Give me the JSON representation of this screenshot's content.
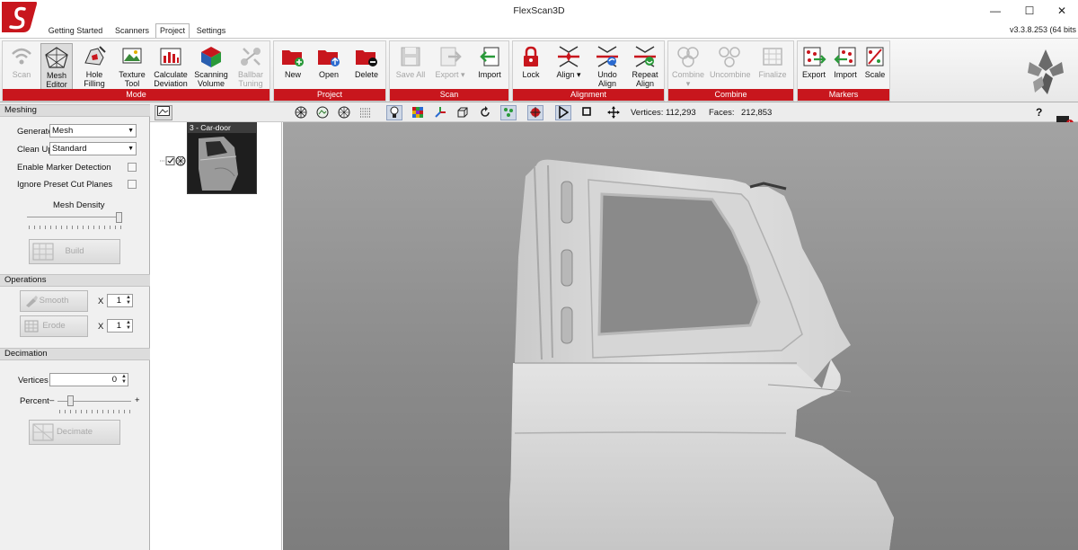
{
  "window": {
    "title": "FlexScan3D",
    "version": "v3.3.8.253  (64 bits"
  },
  "tabs": [
    "Getting Started",
    "Scanners",
    "Project",
    "Settings"
  ],
  "ribbon": {
    "groups": [
      {
        "label": "Mode",
        "buttons": [
          {
            "line1": "Scan",
            "line2": "",
            "state": "disabled"
          },
          {
            "line1": "Mesh",
            "line2": "Editor",
            "state": "selected"
          },
          {
            "line1": "Hole",
            "line2": "Filling",
            "state": "normal"
          },
          {
            "line1": "Texture",
            "line2": "Tool",
            "state": "normal"
          },
          {
            "line1": "Calculate",
            "line2": "Deviation",
            "state": "normal"
          },
          {
            "line1": "Scanning",
            "line2": "Volume",
            "state": "normal"
          },
          {
            "line1": "Ballbar",
            "line2": "Tuning",
            "state": "disabled"
          }
        ]
      },
      {
        "label": "Project",
        "buttons": [
          {
            "line1": "New",
            "line2": "",
            "state": "normal"
          },
          {
            "line1": "Open",
            "line2": "",
            "state": "normal"
          },
          {
            "line1": "Delete",
            "line2": "",
            "state": "normal"
          }
        ]
      },
      {
        "label": "Scan",
        "buttons": [
          {
            "line1": "Save All",
            "line2": "",
            "state": "disabled"
          },
          {
            "line1": "Export ▾",
            "line2": "",
            "state": "disabled"
          },
          {
            "line1": "Import",
            "line2": "",
            "state": "normal"
          }
        ]
      },
      {
        "label": "Alignment",
        "buttons": [
          {
            "line1": "Lock",
            "line2": "",
            "state": "normal"
          },
          {
            "line1": "Align ▾",
            "line2": "",
            "state": "normal"
          },
          {
            "line1": "Undo",
            "line2": "Align",
            "state": "normal"
          },
          {
            "line1": "Repeat",
            "line2": "Align",
            "state": "normal"
          }
        ]
      },
      {
        "label": "Combine",
        "buttons": [
          {
            "line1": "Combine",
            "line2": "▾",
            "state": "disabled"
          },
          {
            "line1": "Uncombine",
            "line2": "",
            "state": "disabled"
          },
          {
            "line1": "Finalize",
            "line2": "",
            "state": "disabled"
          }
        ]
      },
      {
        "label": "Markers",
        "buttons": [
          {
            "line1": "Export",
            "line2": "",
            "state": "normal"
          },
          {
            "line1": "Import",
            "line2": "",
            "state": "normal"
          },
          {
            "line1": "Scale",
            "line2": "",
            "state": "normal"
          }
        ]
      }
    ]
  },
  "viewbar": {
    "vertices_label": "Vertices:",
    "vertices_value": "112,293",
    "faces_label": "Faces:",
    "faces_value": "212,853",
    "help": "?"
  },
  "panel": {
    "meshing": {
      "title": "Meshing",
      "generate_label": "Generate",
      "generate_value": "Mesh",
      "cleanup_label": "Clean Up",
      "cleanup_value": "Standard",
      "marker_detection_label": "Enable Marker Detection",
      "ignore_planes_label": "Ignore Preset Cut Planes",
      "density_label": "Mesh Density",
      "density_level": 1.0,
      "build_label": "Build"
    },
    "operations": {
      "title": "Operations",
      "smooth_label": "Smooth",
      "smooth_x": "X",
      "smooth_value": "1",
      "erode_label": "Erode",
      "erode_x": "X",
      "erode_value": "1"
    },
    "decimation": {
      "title": "Decimation",
      "vertices_label": "Vertices",
      "vertices_value": "0",
      "percent_label": "Percent",
      "minus": "–",
      "plus": "+",
      "percent_level": 0.15,
      "decimate_label": "Decimate"
    }
  },
  "tree": {
    "item_label": "3 - Car-door"
  }
}
